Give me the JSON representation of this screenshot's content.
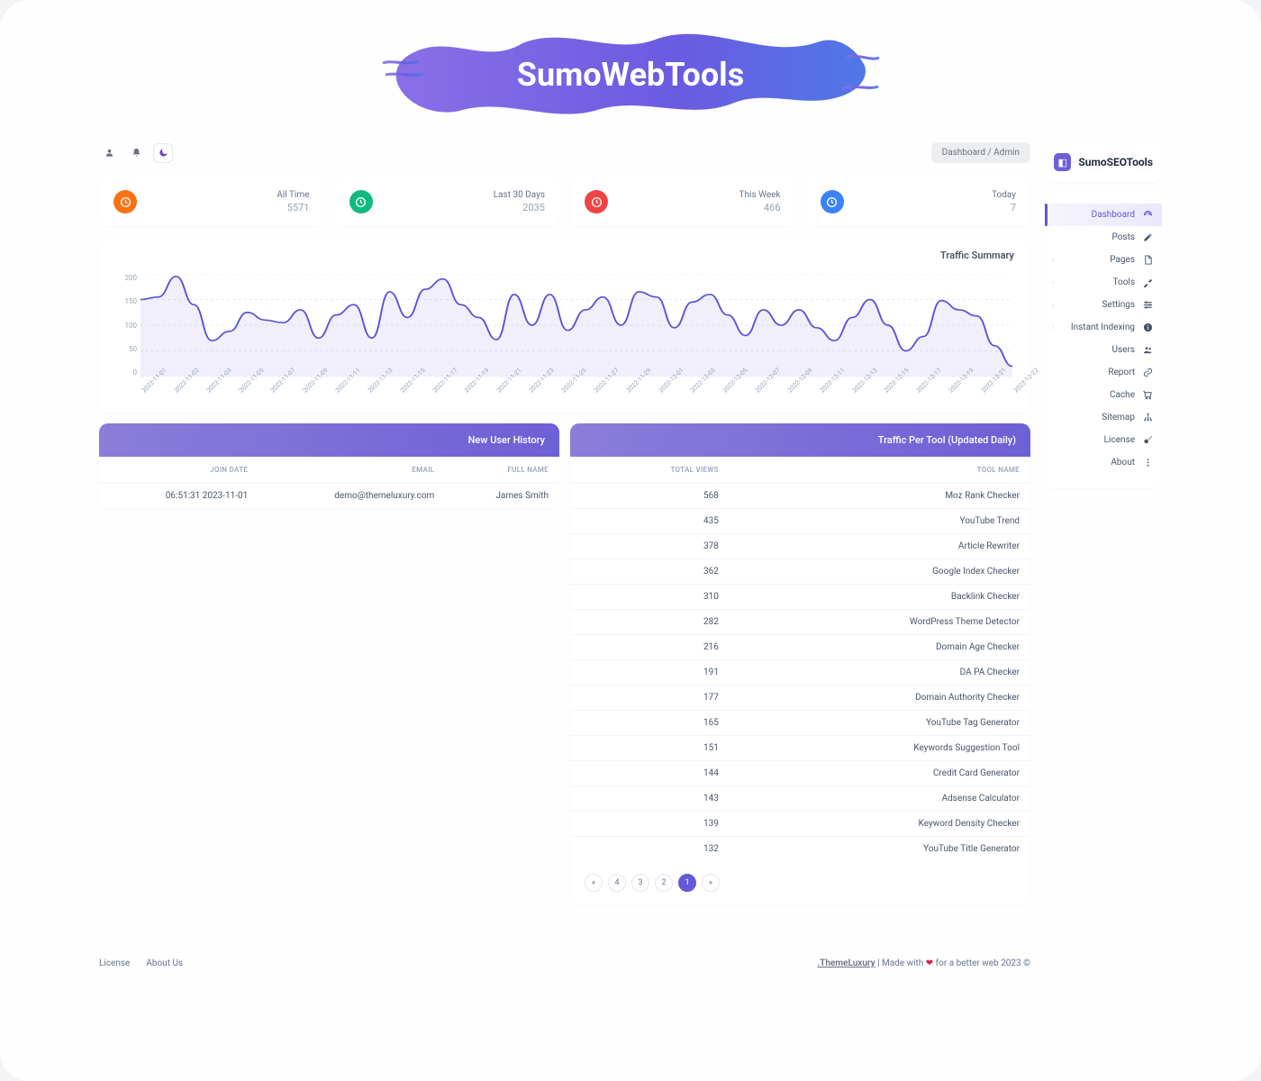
{
  "banner": {
    "title": "SumoWebTools"
  },
  "topbar": {
    "breadcrumb_parent": "Dashboard",
    "breadcrumb_sep": "/",
    "breadcrumb_current": "Admin"
  },
  "stats": [
    {
      "label": "All Time",
      "value": "5571",
      "color": "#f97316"
    },
    {
      "label": "Last 30 Days",
      "value": "2035",
      "color": "#10b981"
    },
    {
      "label": "This Week",
      "value": "466",
      "color": "#ef4444"
    },
    {
      "label": "Today",
      "value": "7",
      "color": "#3b82f6"
    }
  ],
  "chart": {
    "title": "Traffic Summary"
  },
  "chart_data": {
    "type": "line",
    "title": "Traffic Summary",
    "xlabel": "",
    "ylabel": "",
    "ylim": [
      0,
      200
    ],
    "ticks_y": [
      200,
      150,
      100,
      50,
      0
    ],
    "categories": [
      "2022-11-01",
      "2022-11-02",
      "2022-11-03",
      "2022-11-05",
      "2022-11-07",
      "2022-11-09",
      "2022-11-11",
      "2022-11-13",
      "2022-11-15",
      "2022-11-17",
      "2022-11-19",
      "2022-11-21",
      "2022-11-23",
      "2022-11-25",
      "2022-11-27",
      "2022-11-29",
      "2022-12-01",
      "2022-12-03",
      "2022-12-05",
      "2022-12-07",
      "2022-12-09",
      "2022-12-11",
      "2022-12-13",
      "2022-12-15",
      "2022-12-17",
      "2022-12-19",
      "2022-12-21",
      "2022-12-22"
    ],
    "values": [
      150,
      155,
      195,
      140,
      70,
      88,
      125,
      110,
      105,
      130,
      75,
      120,
      140,
      75,
      165,
      115,
      170,
      190,
      140,
      115,
      72,
      160,
      100,
      160,
      90,
      130,
      155,
      100,
      165,
      155,
      95,
      145,
      160,
      120,
      80,
      130,
      100,
      130,
      95,
      70,
      115,
      150,
      100,
      50,
      78,
      148,
      130,
      118,
      60,
      20
    ]
  },
  "user_history": {
    "title": "New User History",
    "cols": {
      "a": "JOIN DATE",
      "b": "EMAIL",
      "c": "FULL NAME"
    },
    "rows": [
      {
        "a": "06:51:31 2023-11-01",
        "b": "demo@themeluxury.com",
        "c": "James Smith"
      }
    ]
  },
  "traffic_tool": {
    "title": "Traffic Per Tool (Updated Daily)",
    "cols": {
      "a": "TOTAL VIEWS",
      "b": "TOOL NAME"
    },
    "rows": [
      {
        "a": "568",
        "b": "Moz Rank Checker"
      },
      {
        "a": "435",
        "b": "YouTube Trend"
      },
      {
        "a": "378",
        "b": "Article Rewriter"
      },
      {
        "a": "362",
        "b": "Google Index Checker"
      },
      {
        "a": "310",
        "b": "Backlink Checker"
      },
      {
        "a": "282",
        "b": "WordPress Theme Detector"
      },
      {
        "a": "216",
        "b": "Domain Age Checker"
      },
      {
        "a": "191",
        "b": "DA PA Checker"
      },
      {
        "a": "177",
        "b": "Domain Authority Checker"
      },
      {
        "a": "165",
        "b": "YouTube Tag Generator"
      },
      {
        "a": "151",
        "b": "Keywords Suggestion Tool"
      },
      {
        "a": "144",
        "b": "Credit Card Generator"
      },
      {
        "a": "143",
        "b": "Adsense Calculator"
      },
      {
        "a": "139",
        "b": "Keyword Density Checker"
      },
      {
        "a": "132",
        "b": "YouTube Title Generator"
      }
    ],
    "pages": [
      "«",
      "4",
      "3",
      "2",
      "1",
      "»"
    ],
    "active_page": "1"
  },
  "sidebar": {
    "brand": "SumoSEOTools",
    "items": [
      {
        "label": "Dashboard",
        "icon": "speed",
        "active": true,
        "expand": false
      },
      {
        "label": "Posts",
        "icon": "pencil",
        "active": false,
        "expand": false
      },
      {
        "label": "Pages",
        "icon": "file",
        "active": false,
        "expand": true
      },
      {
        "label": "Tools",
        "icon": "tools",
        "active": false,
        "expand": true
      },
      {
        "label": "Settings",
        "icon": "sliders",
        "active": false,
        "expand": true
      },
      {
        "label": "Instant Indexing",
        "icon": "info",
        "active": false,
        "expand": true
      },
      {
        "label": "Users",
        "icon": "users",
        "active": false,
        "expand": false
      },
      {
        "label": "Report",
        "icon": "link",
        "active": false,
        "expand": false
      },
      {
        "label": "Cache",
        "icon": "cart",
        "active": false,
        "expand": false
      },
      {
        "label": "Sitemap",
        "icon": "sitemap",
        "active": false,
        "expand": false
      },
      {
        "label": "License",
        "icon": "key",
        "active": false,
        "expand": false
      },
      {
        "label": "About",
        "icon": "more",
        "active": false,
        "expand": false
      }
    ]
  },
  "footer": {
    "license": "License",
    "about": "About Us",
    "prefix": ".ThemeLuxury",
    "mid": " | Made with ",
    "suffix": " for a better web 2023 ©"
  }
}
